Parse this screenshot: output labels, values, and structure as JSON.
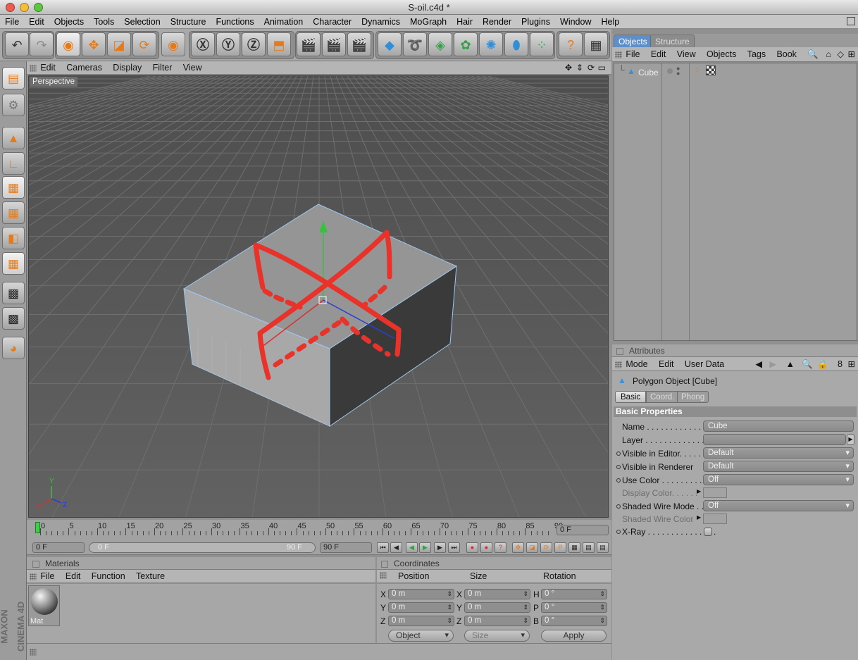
{
  "window": {
    "title": "S-oil.c4d *"
  },
  "menubar": [
    "File",
    "Edit",
    "Objects",
    "Tools",
    "Selection",
    "Structure",
    "Functions",
    "Animation",
    "Character",
    "Dynamics",
    "MoGraph",
    "Hair",
    "Render",
    "Plugins",
    "Window",
    "Help"
  ],
  "viewport": {
    "menu": [
      "Edit",
      "Cameras",
      "Display",
      "Filter",
      "View"
    ],
    "label": "Perspective",
    "axis": {
      "x": "X",
      "y": "Y",
      "z": "Z"
    }
  },
  "timeline": {
    "ticks": [
      "0",
      "5",
      "10",
      "15",
      "20",
      "25",
      "30",
      "35",
      "40",
      "45",
      "50",
      "55",
      "60",
      "65",
      "70",
      "75",
      "80",
      "85",
      "90"
    ],
    "current_frame": "0 F",
    "start": "0 F",
    "range_start": "0 F",
    "range_end": "90 F",
    "end": "90 F"
  },
  "materials": {
    "title": "Materials",
    "menu": [
      "File",
      "Edit",
      "Function",
      "Texture"
    ],
    "items": [
      {
        "name": "Mat"
      }
    ]
  },
  "coordinates": {
    "title": "Coordinates",
    "headers": [
      "Position",
      "Size",
      "Rotation"
    ],
    "rows": [
      {
        "pos_label": "X",
        "pos": "0 m",
        "size_label": "X",
        "size": "0 m",
        "rot_label": "H",
        "rot": "0 °"
      },
      {
        "pos_label": "Y",
        "pos": "0 m",
        "size_label": "Y",
        "size": "0 m",
        "rot_label": "P",
        "rot": "0 °"
      },
      {
        "pos_label": "Z",
        "pos": "0 m",
        "size_label": "Z",
        "size": "0 m",
        "rot_label": "B",
        "rot": "0 °"
      }
    ],
    "mode": "Object",
    "size_mode": "Size",
    "apply_label": "Apply"
  },
  "objects": {
    "tabs": [
      "Objects",
      "Structure"
    ],
    "menu": [
      "File",
      "Edit",
      "View",
      "Objects",
      "Tags",
      "Book"
    ],
    "items": [
      {
        "name": "Cube"
      }
    ]
  },
  "attributes": {
    "title": "Attributes",
    "menu": [
      "Mode",
      "Edit",
      "User Data"
    ],
    "object_title": "Polygon Object [Cube]",
    "tabs": [
      "Basic",
      "Coord.",
      "Phong"
    ],
    "section": "Basic Properties",
    "props": {
      "name": {
        "label": "Name . . . . . . . . . . . . . . .",
        "value": "Cube"
      },
      "layer": {
        "label": "Layer . . . . . . . . . . . . . . . .",
        "value": ""
      },
      "visible_editor": {
        "label": "Visible in Editor. . . . .",
        "value": "Default"
      },
      "visible_renderer": {
        "label": "Visible in Renderer",
        "value": "Default"
      },
      "use_color": {
        "label": "Use Color . . . . . . . . . . .",
        "value": "Off"
      },
      "display_color": {
        "label": "Display Color. . . . . ."
      },
      "shaded_wire_mode": {
        "label": "Shaded Wire Mode . . .",
        "value": "Off"
      },
      "shaded_wire_color": {
        "label": "Shaded Wire Color"
      },
      "xray": {
        "label": "X-Ray . . . . . . . . . . . . . . ."
      }
    }
  },
  "branding": {
    "line1": "MAXON",
    "line2": "CINEMA 4D"
  },
  "colors": {
    "accent": "#e77a18",
    "sketch": "#e8322a",
    "selection": "#3c8ed6"
  }
}
